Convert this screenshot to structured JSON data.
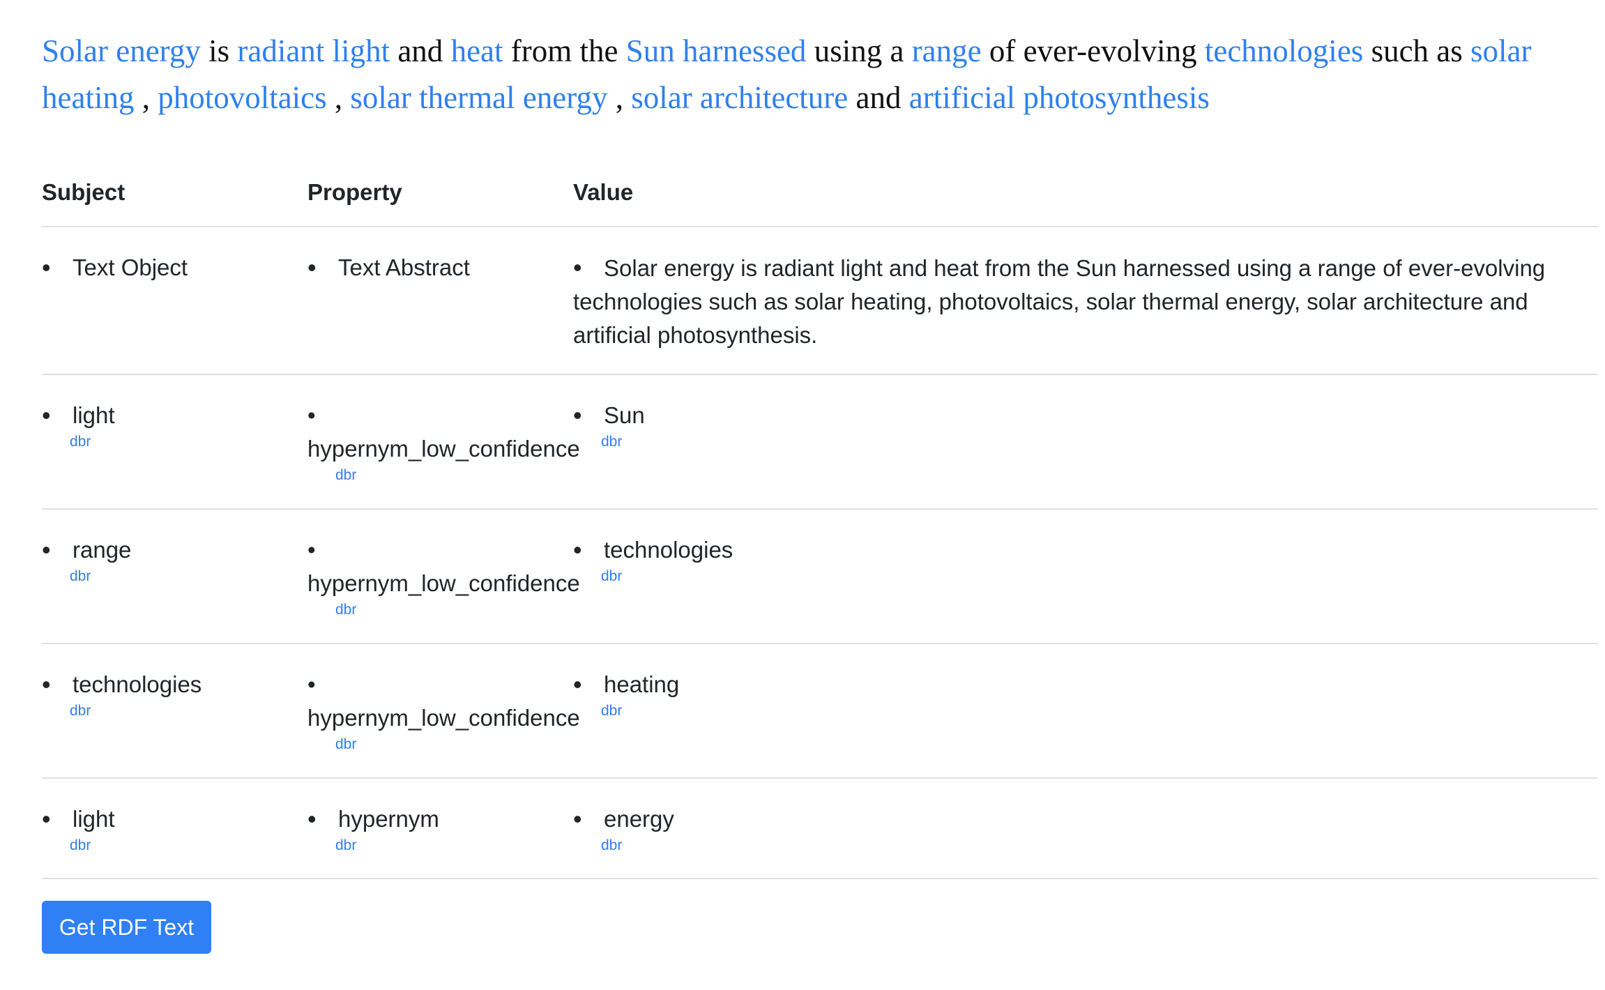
{
  "intro": [
    {
      "t": "Solar energy",
      "link": true
    },
    {
      "t": " is ",
      "link": false
    },
    {
      "t": "radiant light",
      "link": true
    },
    {
      "t": " and ",
      "link": false
    },
    {
      "t": "heat",
      "link": true
    },
    {
      "t": " from the ",
      "link": false
    },
    {
      "t": "Sun harnessed",
      "link": true
    },
    {
      "t": " using a ",
      "link": false
    },
    {
      "t": "range",
      "link": true
    },
    {
      "t": " of ever-evolving ",
      "link": false
    },
    {
      "t": "technologies",
      "link": true
    },
    {
      "t": " such as ",
      "link": false
    },
    {
      "t": "solar heating",
      "link": true
    },
    {
      "t": " , ",
      "link": false
    },
    {
      "t": "photovoltaics",
      "link": true
    },
    {
      "t": " , ",
      "link": false
    },
    {
      "t": "solar thermal energy",
      "link": true
    },
    {
      "t": " , ",
      "link": false
    },
    {
      "t": "solar architecture",
      "link": true
    },
    {
      "t": " and ",
      "link": false
    },
    {
      "t": "artificial photosynthesis",
      "link": true
    }
  ],
  "table": {
    "headers": {
      "subject": "Subject",
      "property": "Property",
      "value": "Value"
    },
    "bullet": "•",
    "dbr_label": "dbr",
    "rows": [
      {
        "subject": "Text Object",
        "property": "Text Abstract",
        "value": "Solar energy is radiant light and heat from the Sun harnessed using a range of ever-evolving technologies such as solar heating, photovoltaics, solar thermal energy, solar architecture and artificial photosynthesis."
      },
      {
        "subject": "light",
        "property": "hypernym_low_confidence",
        "value": "Sun"
      },
      {
        "subject": "range",
        "property": "hypernym_low_confidence",
        "value": "technologies"
      },
      {
        "subject": "technologies",
        "property": "hypernym_low_confidence",
        "value": "heating"
      },
      {
        "subject": "light",
        "property": "hypernym",
        "value": "energy"
      }
    ]
  },
  "button": {
    "label": "Get RDF Text"
  },
  "colors": {
    "link": "#2f80ed",
    "button": "#2f80f5"
  }
}
